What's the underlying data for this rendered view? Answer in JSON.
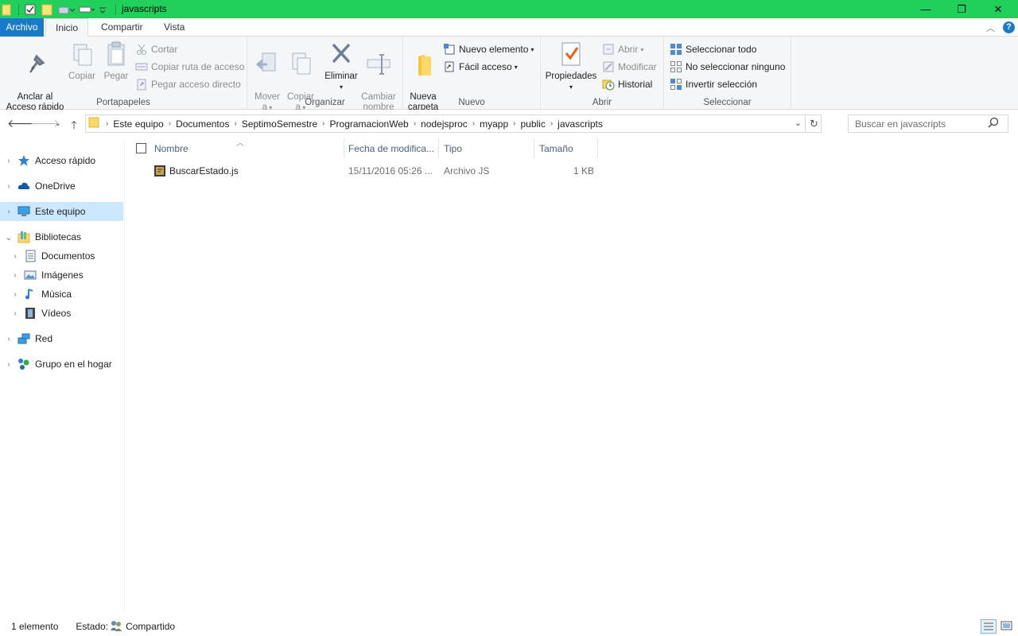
{
  "window": {
    "title": "javascripts",
    "accent_color": "#21d05a",
    "controls": {
      "minimize": "—",
      "maximize": "❐",
      "close": "✕"
    }
  },
  "tabs": [
    {
      "label": "Archivo",
      "active": false
    },
    {
      "label": "Inicio",
      "active": true
    },
    {
      "label": "Compartir",
      "active": false
    },
    {
      "label": "Vista",
      "active": false
    }
  ],
  "ribbon": {
    "portapapeles": {
      "label": "Portapapeles",
      "pin": "Anclar al\nAcceso rápido",
      "copy": "Copiar",
      "paste": "Pegar",
      "cut": "Cortar",
      "copy_path": "Copiar ruta de acceso",
      "paste_shortcut": "Pegar acceso directo"
    },
    "organizar": {
      "label": "Organizar",
      "move_to": "Mover\na",
      "copy_to": "Copiar\na",
      "delete": "Eliminar",
      "rename": "Cambiar\nnombre"
    },
    "nuevo": {
      "label": "Nuevo",
      "new_folder": "Nueva\ncarpeta",
      "new_item": "Nuevo elemento",
      "easy_access": "Fácil acceso"
    },
    "abrir": {
      "label": "Abrir",
      "properties": "Propiedades",
      "open": "Abrir",
      "edit": "Modificar",
      "history": "Historial"
    },
    "seleccionar": {
      "label": "Seleccionar",
      "select_all": "Seleccionar todo",
      "select_none": "No seleccionar ninguno",
      "invert": "Invertir selección"
    }
  },
  "address": {
    "crumbs": [
      "Este equipo",
      "Documentos",
      "SeptimoSemestre",
      "ProgramacionWeb",
      "nodejsproc",
      "myapp",
      "public",
      "javascripts"
    ]
  },
  "search": {
    "placeholder": "Buscar en javascripts"
  },
  "nav": [
    {
      "label": "Acceso rápido",
      "icon": "star-icon",
      "expanded": false,
      "selected": false,
      "indent": 0
    },
    {
      "label": "OneDrive",
      "icon": "cloud-icon",
      "expanded": false,
      "selected": false,
      "indent": 0
    },
    {
      "label": "Este equipo",
      "icon": "computer-icon",
      "expanded": false,
      "selected": true,
      "indent": 0
    },
    {
      "label": "Bibliotecas",
      "icon": "libraries-icon",
      "expanded": true,
      "selected": false,
      "indent": 0
    },
    {
      "label": "Documentos",
      "icon": "documents-icon",
      "expanded": false,
      "selected": false,
      "indent": 1
    },
    {
      "label": "Imágenes",
      "icon": "pictures-icon",
      "expanded": false,
      "selected": false,
      "indent": 1
    },
    {
      "label": "Música",
      "icon": "music-icon",
      "expanded": false,
      "selected": false,
      "indent": 1
    },
    {
      "label": "Vídeos",
      "icon": "videos-icon",
      "expanded": false,
      "selected": false,
      "indent": 1
    },
    {
      "label": "Red",
      "icon": "network-icon",
      "expanded": false,
      "selected": false,
      "indent": 0
    },
    {
      "label": "Grupo en el hogar",
      "icon": "homegroup-icon",
      "expanded": false,
      "selected": false,
      "indent": 0
    }
  ],
  "columns": {
    "name": "Nombre",
    "date": "Fecha de modifica...",
    "type": "Tipo",
    "size": "Tamaño"
  },
  "files": [
    {
      "name": "BuscarEstado.js",
      "date": "15/11/2016 05:26 ...",
      "type": "Archivo JS",
      "size": "1 KB"
    }
  ],
  "status": {
    "count": "1 elemento",
    "state_label": "Estado:",
    "state_value": "Compartido"
  }
}
